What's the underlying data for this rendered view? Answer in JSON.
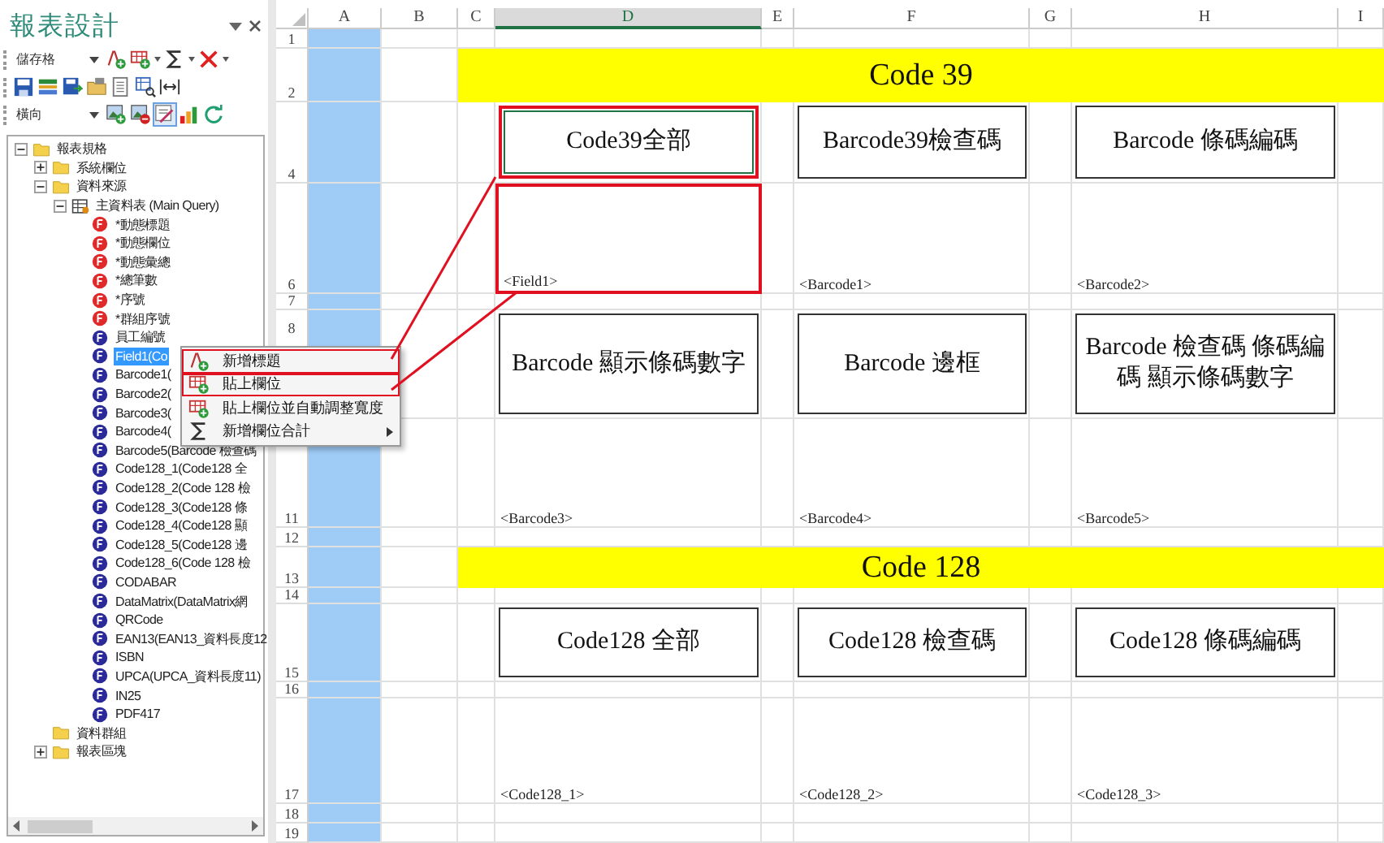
{
  "panel": {
    "title": "報表設計",
    "toolbar_rows": [
      {
        "combo": "儲存格",
        "tools": [
          {
            "kind": "text-add"
          },
          {
            "kind": "grid-add"
          },
          {
            "kind": "sum"
          },
          {
            "kind": "delete"
          }
        ]
      },
      {
        "tools": [
          {
            "kind": "save"
          },
          {
            "kind": "header-band"
          },
          {
            "kind": "save-as"
          },
          {
            "kind": "db-open"
          },
          {
            "kind": "sheet"
          },
          {
            "kind": "grid-search"
          },
          {
            "kind": "fit-width"
          }
        ]
      },
      {
        "combo": "橫向",
        "tools": [
          {
            "kind": "image-add"
          },
          {
            "kind": "image-remove"
          },
          {
            "kind": "pen-edit"
          },
          {
            "kind": "chart"
          },
          {
            "kind": "refresh"
          }
        ]
      }
    ],
    "tree": [
      {
        "label": "報表規格",
        "kind": "folder",
        "expanded": true,
        "children": [
          {
            "label": "系統欄位",
            "kind": "folder",
            "expanded": false
          },
          {
            "label": "資料來源",
            "kind": "folder",
            "expanded": true,
            "children": [
              {
                "label": "主資料表 (Main Query)",
                "kind": "table",
                "expanded": true,
                "children": [
                  {
                    "label": "*動態標題",
                    "kind": "calc-field",
                    "selected": false
                  },
                  {
                    "label": "*動態欄位",
                    "kind": "calc-field",
                    "selected": false
                  },
                  {
                    "label": "*動態彙總",
                    "kind": "calc-field",
                    "selected": false
                  },
                  {
                    "label": "*總筆數",
                    "kind": "calc-field",
                    "selected": false
                  },
                  {
                    "label": "*序號",
                    "kind": "calc-field",
                    "selected": false
                  },
                  {
                    "label": "*群組序號",
                    "kind": "calc-field",
                    "selected": false
                  },
                  {
                    "label": "員工編號",
                    "kind": "field",
                    "selected": false
                  },
                  {
                    "label": "Field1(Co",
                    "kind": "field",
                    "selected": true
                  },
                  {
                    "label": "Barcode1(",
                    "kind": "field",
                    "selected": false
                  },
                  {
                    "label": "Barcode2(",
                    "kind": "field",
                    "selected": false
                  },
                  {
                    "label": "Barcode3(",
                    "kind": "field",
                    "selected": false
                  },
                  {
                    "label": "Barcode4(",
                    "kind": "field",
                    "selected": false
                  },
                  {
                    "label": "Barcode5(Barcode 檢查碼",
                    "kind": "field",
                    "selected": false
                  },
                  {
                    "label": "Code128_1(Code128 全",
                    "kind": "field",
                    "selected": false
                  },
                  {
                    "label": "Code128_2(Code 128 檢",
                    "kind": "field",
                    "selected": false
                  },
                  {
                    "label": "Code128_3(Code128 條",
                    "kind": "field",
                    "selected": false
                  },
                  {
                    "label": "Code128_4(Code128 顯",
                    "kind": "field",
                    "selected": false
                  },
                  {
                    "label": "Code128_5(Code128 邊",
                    "kind": "field",
                    "selected": false
                  },
                  {
                    "label": "Code128_6(Code 128 檢",
                    "kind": "field",
                    "selected": false
                  },
                  {
                    "label": "CODABAR",
                    "kind": "field",
                    "selected": false
                  },
                  {
                    "label": "DataMatrix(DataMatrix網",
                    "kind": "field",
                    "selected": false
                  },
                  {
                    "label": "QRCode",
                    "kind": "field",
                    "selected": false
                  },
                  {
                    "label": "EAN13(EAN13_資料長度12",
                    "kind": "field",
                    "selected": false
                  },
                  {
                    "label": "ISBN",
                    "kind": "field",
                    "selected": false
                  },
                  {
                    "label": "UPCA(UPCA_資料長度11)",
                    "kind": "field",
                    "selected": false
                  },
                  {
                    "label": "IN25",
                    "kind": "field",
                    "selected": false
                  },
                  {
                    "label": "PDF417",
                    "kind": "field",
                    "selected": false
                  }
                ]
              }
            ]
          },
          {
            "label": "資料群組",
            "kind": "folder"
          },
          {
            "label": "報表區塊",
            "kind": "folder",
            "expanded": false
          }
        ]
      }
    ]
  },
  "context_menu": [
    {
      "label": "新增標題",
      "kind": "text-add",
      "annotated": true
    },
    {
      "label": "貼上欄位",
      "kind": "grid-add",
      "annotated": true
    },
    {
      "label": "貼上欄位並自動調整寬度",
      "kind": "grid-add",
      "annotated": false
    },
    {
      "label": "新增欄位合計",
      "kind": "sum",
      "annotated": false,
      "submenu": true
    }
  ],
  "sheet": {
    "columns": [
      {
        "label": "A",
        "selected": false
      },
      {
        "label": "B",
        "selected": false
      },
      {
        "label": "C",
        "selected": false
      },
      {
        "label": "D",
        "selected": true
      },
      {
        "label": "E",
        "selected": false
      },
      {
        "label": "F",
        "selected": false
      },
      {
        "label": "G",
        "selected": false
      },
      {
        "label": "H",
        "selected": false
      },
      {
        "label": "I",
        "selected": false
      }
    ],
    "rows": [
      "1",
      "2",
      "4",
      "6",
      "7",
      "8",
      "11",
      "12",
      "13",
      "14",
      "15",
      "16",
      "17",
      "18",
      "19"
    ],
    "cells": [
      {
        "kind": "banner",
        "text": "Code 39"
      },
      {
        "kind": "box",
        "text": "Code39全部",
        "annotated": true
      },
      {
        "kind": "box",
        "text": "Barcode39檢查碼",
        "annotated": false
      },
      {
        "kind": "box",
        "text": "Barcode 條碼編碼",
        "annotated": false
      },
      {
        "kind": "field",
        "text": "<Field1>",
        "annotated": true
      },
      {
        "kind": "field",
        "text": "<Barcode1>",
        "annotated": false
      },
      {
        "kind": "field",
        "text": "<Barcode2>",
        "annotated": false
      },
      {
        "kind": "box",
        "text": "Barcode  顯示條碼數字",
        "annotated": false
      },
      {
        "kind": "box",
        "text": "Barcode  邊框",
        "annotated": false
      },
      {
        "kind": "box",
        "text": "Barcode 檢查碼 條碼編碼 顯示條碼數字",
        "annotated": false
      },
      {
        "kind": "field",
        "text": "<Barcode3>",
        "annotated": false
      },
      {
        "kind": "field",
        "text": "<Barcode4>",
        "annotated": false
      },
      {
        "kind": "field",
        "text": "<Barcode5>",
        "annotated": false
      },
      {
        "kind": "banner",
        "text": "Code 128"
      },
      {
        "kind": "box",
        "text": "Code128  全部",
        "annotated": false
      },
      {
        "kind": "box",
        "text": "Code128  檢查碼",
        "annotated": false
      },
      {
        "kind": "box",
        "text": "Code128 條碼編碼",
        "annotated": false
      },
      {
        "kind": "field",
        "text": "<Code128_1>",
        "annotated": false
      },
      {
        "kind": "field",
        "text": "<Code128_2>",
        "annotated": false
      },
      {
        "kind": "field",
        "text": "<Code128_3>",
        "annotated": false
      }
    ]
  }
}
